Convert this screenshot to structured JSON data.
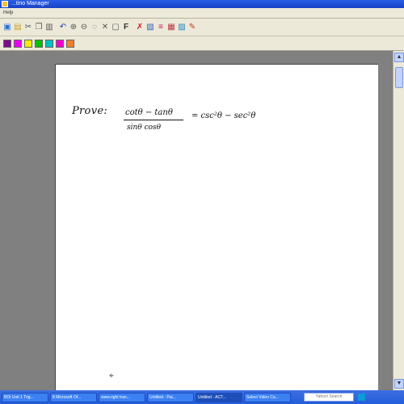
{
  "window": {
    "title": "...tino Manager"
  },
  "menu": {
    "items": [
      "Help"
    ]
  },
  "toolbar": {
    "icons": [
      "new-icon",
      "open-icon",
      "cut-icon",
      "copy-icon",
      "paste-icon",
      "undo-icon",
      "zoom-in-icon",
      "zoom-out-icon",
      "clear-icon",
      "delete-icon",
      "font-icon",
      "insert-icon",
      "eraser-icon",
      "page-icon",
      "select-icon",
      "image-icon",
      "chart-icon",
      "pen-icon"
    ]
  },
  "palette": {
    "colors": [
      "#7a0d8f",
      "#f000f0",
      "#f0f000",
      "#00c000",
      "#00c0c0",
      "#f000d0",
      "#f08030"
    ]
  },
  "canvas": {
    "prove_label": "Prove:",
    "numerator": "cotθ − tanθ",
    "denominator": "sinθ cosθ",
    "rhs": "= csc²θ − sec²θ"
  },
  "taskbar": {
    "tasks": [
      "BDI Unit 1 Trig...",
      "8 Microsoft Of...",
      "www.right tran...",
      "Untitled - Pai...",
      "Untitled - ACT...",
      "Select Video Ca..."
    ],
    "active_index": 4,
    "search_label": "Yahoo! Search"
  }
}
